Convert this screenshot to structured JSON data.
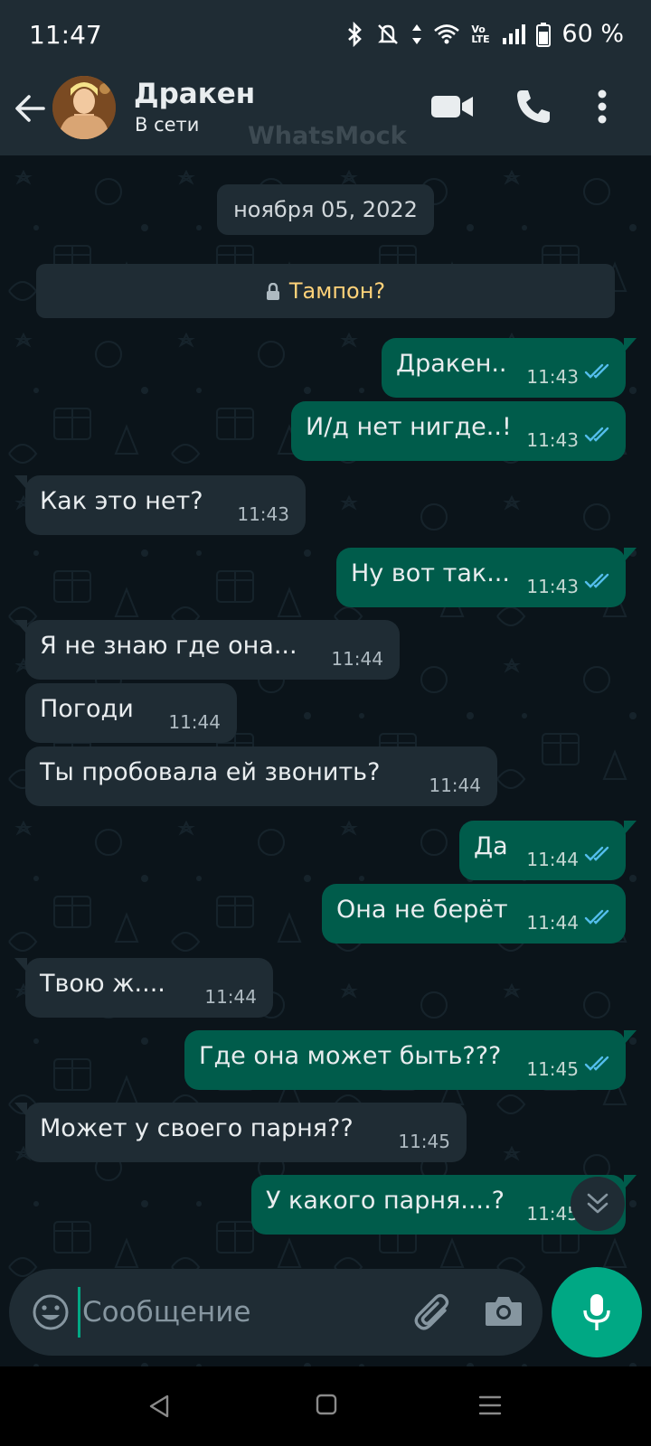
{
  "status_bar": {
    "time": "11:47",
    "battery": "60 %",
    "volte": "Vo LTE"
  },
  "header": {
    "contact_name": "Дракен",
    "contact_status": "В сети",
    "watermark": "WhatsMock"
  },
  "chat": {
    "date": "ноября 05, 2022",
    "encryption_notice": "Тампон?",
    "messages": [
      {
        "dir": "out",
        "text": "Дракен..",
        "time": "11:43"
      },
      {
        "dir": "out",
        "text": "И/д нет нигде..!",
        "time": "11:43"
      },
      {
        "dir": "in",
        "text": "Как это нет?",
        "time": "11:43"
      },
      {
        "dir": "out",
        "text": "Ну вот так...",
        "time": "11:43"
      },
      {
        "dir": "in",
        "text": "Я не знаю где она...",
        "time": "11:44"
      },
      {
        "dir": "in",
        "text": "Погоди",
        "time": "11:44"
      },
      {
        "dir": "in",
        "text": "Ты пробовала ей звонить?",
        "time": "11:44"
      },
      {
        "dir": "out",
        "text": "Да",
        "time": "11:44"
      },
      {
        "dir": "out",
        "text": "Она не берёт",
        "time": "11:44"
      },
      {
        "dir": "in",
        "text": "Твою ж....",
        "time": "11:44"
      },
      {
        "dir": "out",
        "text": "Где она может быть???",
        "time": "11:45"
      },
      {
        "dir": "in",
        "text": "Может у своего парня??",
        "time": "11:45"
      },
      {
        "dir": "out",
        "text": "У какого парня....?",
        "time": "11:45"
      }
    ]
  },
  "composer": {
    "placeholder": "Сообщение",
    "value": ""
  },
  "colors": {
    "outgoing_bubble": "#005c4b",
    "incoming_bubble": "#1f2c34",
    "accent": "#00a884",
    "read_ticks": "#53bdeb",
    "background": "#0b141a"
  }
}
